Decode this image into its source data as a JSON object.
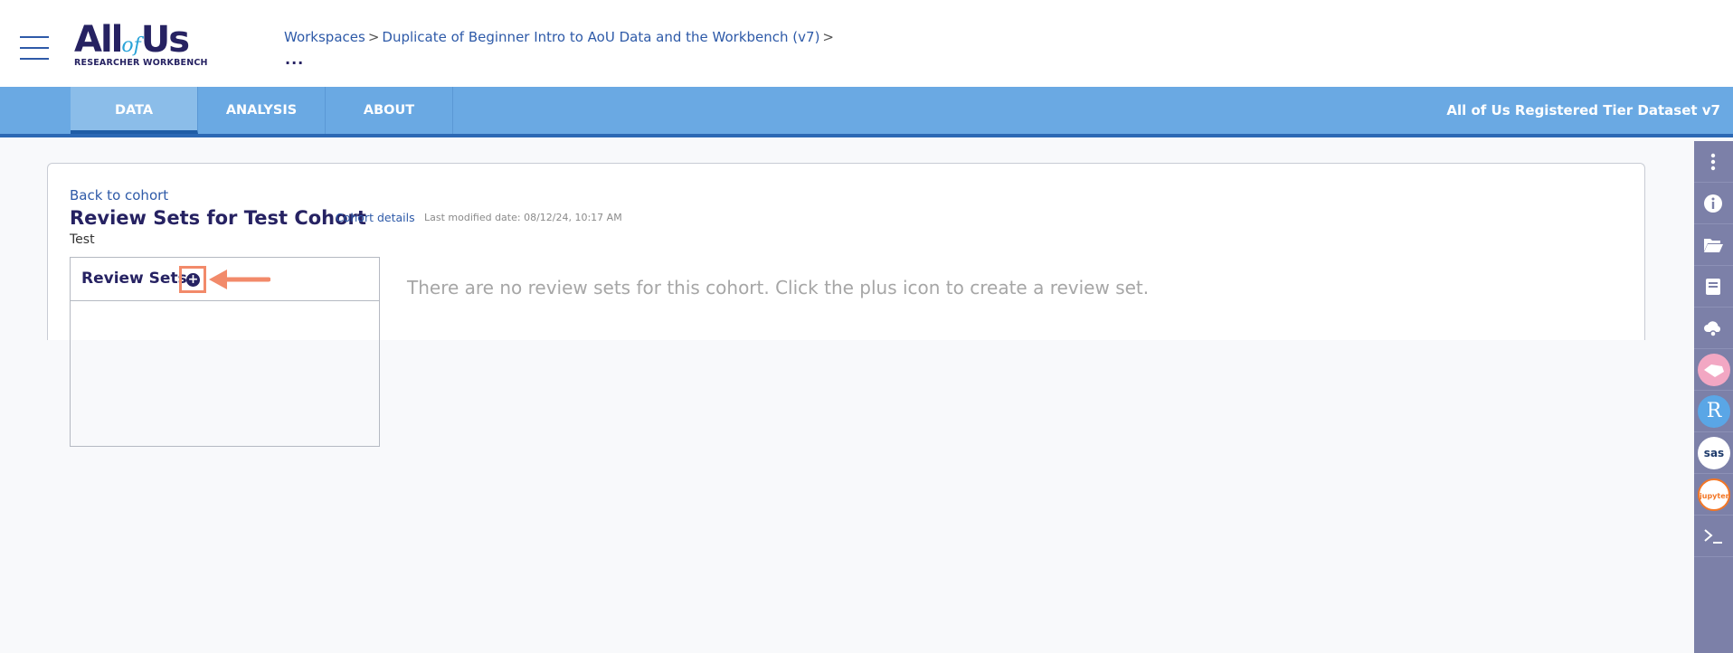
{
  "header": {
    "logo": {
      "main_left": "All",
      "main_of": "of",
      "main_right": "Us",
      "sub": "RESEARCHER WORKBENCH"
    },
    "breadcrumb": {
      "workspaces": "Workspaces",
      "workspace_name": "Duplicate of Beginner Intro to AoU Data and the Workbench (v7)",
      "separator": ">",
      "more": "..."
    }
  },
  "nav": {
    "tabs": [
      {
        "label": "DATA",
        "active": true
      },
      {
        "label": "ANALYSIS",
        "active": false
      },
      {
        "label": "ABOUT",
        "active": false
      }
    ],
    "dataset": "All of Us Registered Tier Dataset v7"
  },
  "main": {
    "back_link": "Back to cohort",
    "title": "Review Sets for Test Cohort",
    "cohort_details": "Cohort details",
    "last_modified": "Last modified date: 08/12/24, 10:17 AM",
    "description": "Test",
    "review_sets_title": "Review Sets",
    "empty_message": "There are no review sets for this cohort. Click the plus icon to create a review set."
  },
  "sidebar": {
    "items": [
      {
        "icon": "more-vertical-icon"
      },
      {
        "icon": "info-icon"
      },
      {
        "icon": "folder-open-icon"
      },
      {
        "icon": "book-icon"
      },
      {
        "icon": "cloud-gear-icon"
      },
      {
        "icon": "hail-icon"
      },
      {
        "icon": "r-icon",
        "label": "R"
      },
      {
        "icon": "sas-icon",
        "label": "sas"
      },
      {
        "icon": "jupyter-icon",
        "label": "jupyter"
      },
      {
        "icon": "terminal-icon"
      }
    ]
  },
  "colors": {
    "brand_navy": "#262262",
    "link_blue": "#2e5aa8",
    "nav_blue": "#6aa9e3",
    "sidebar": "#7c80a8",
    "annotation": "#f28a6a"
  }
}
